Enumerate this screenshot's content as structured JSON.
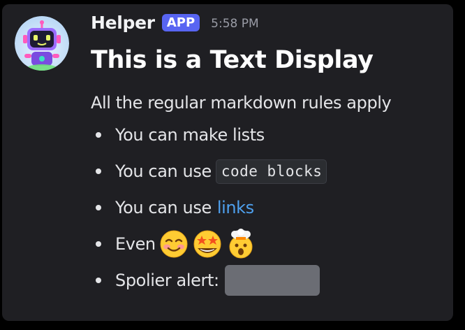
{
  "message": {
    "author": "Helper",
    "badge": "APP",
    "timestamp": "5:58 PM",
    "heading": "This is a Text Display",
    "intro": "All the regular markdown rules apply",
    "bullets": {
      "item1": "You can make lists",
      "item2_prefix": "You can use",
      "item2_code": "code blocks",
      "item3_prefix": "You can use",
      "item3_link": "links",
      "item4_prefix": "Even",
      "item5_prefix": "Spolier alert:"
    },
    "emojis": [
      "smiling-face-with-blush-icon",
      "star-struck-icon",
      "exploding-head-icon"
    ],
    "spoiler_hidden": true
  },
  "colors": {
    "background": "#1f1f23",
    "badge": "#5865f2",
    "link": "#4ea0ee",
    "spoiler": "#6b6d74"
  }
}
